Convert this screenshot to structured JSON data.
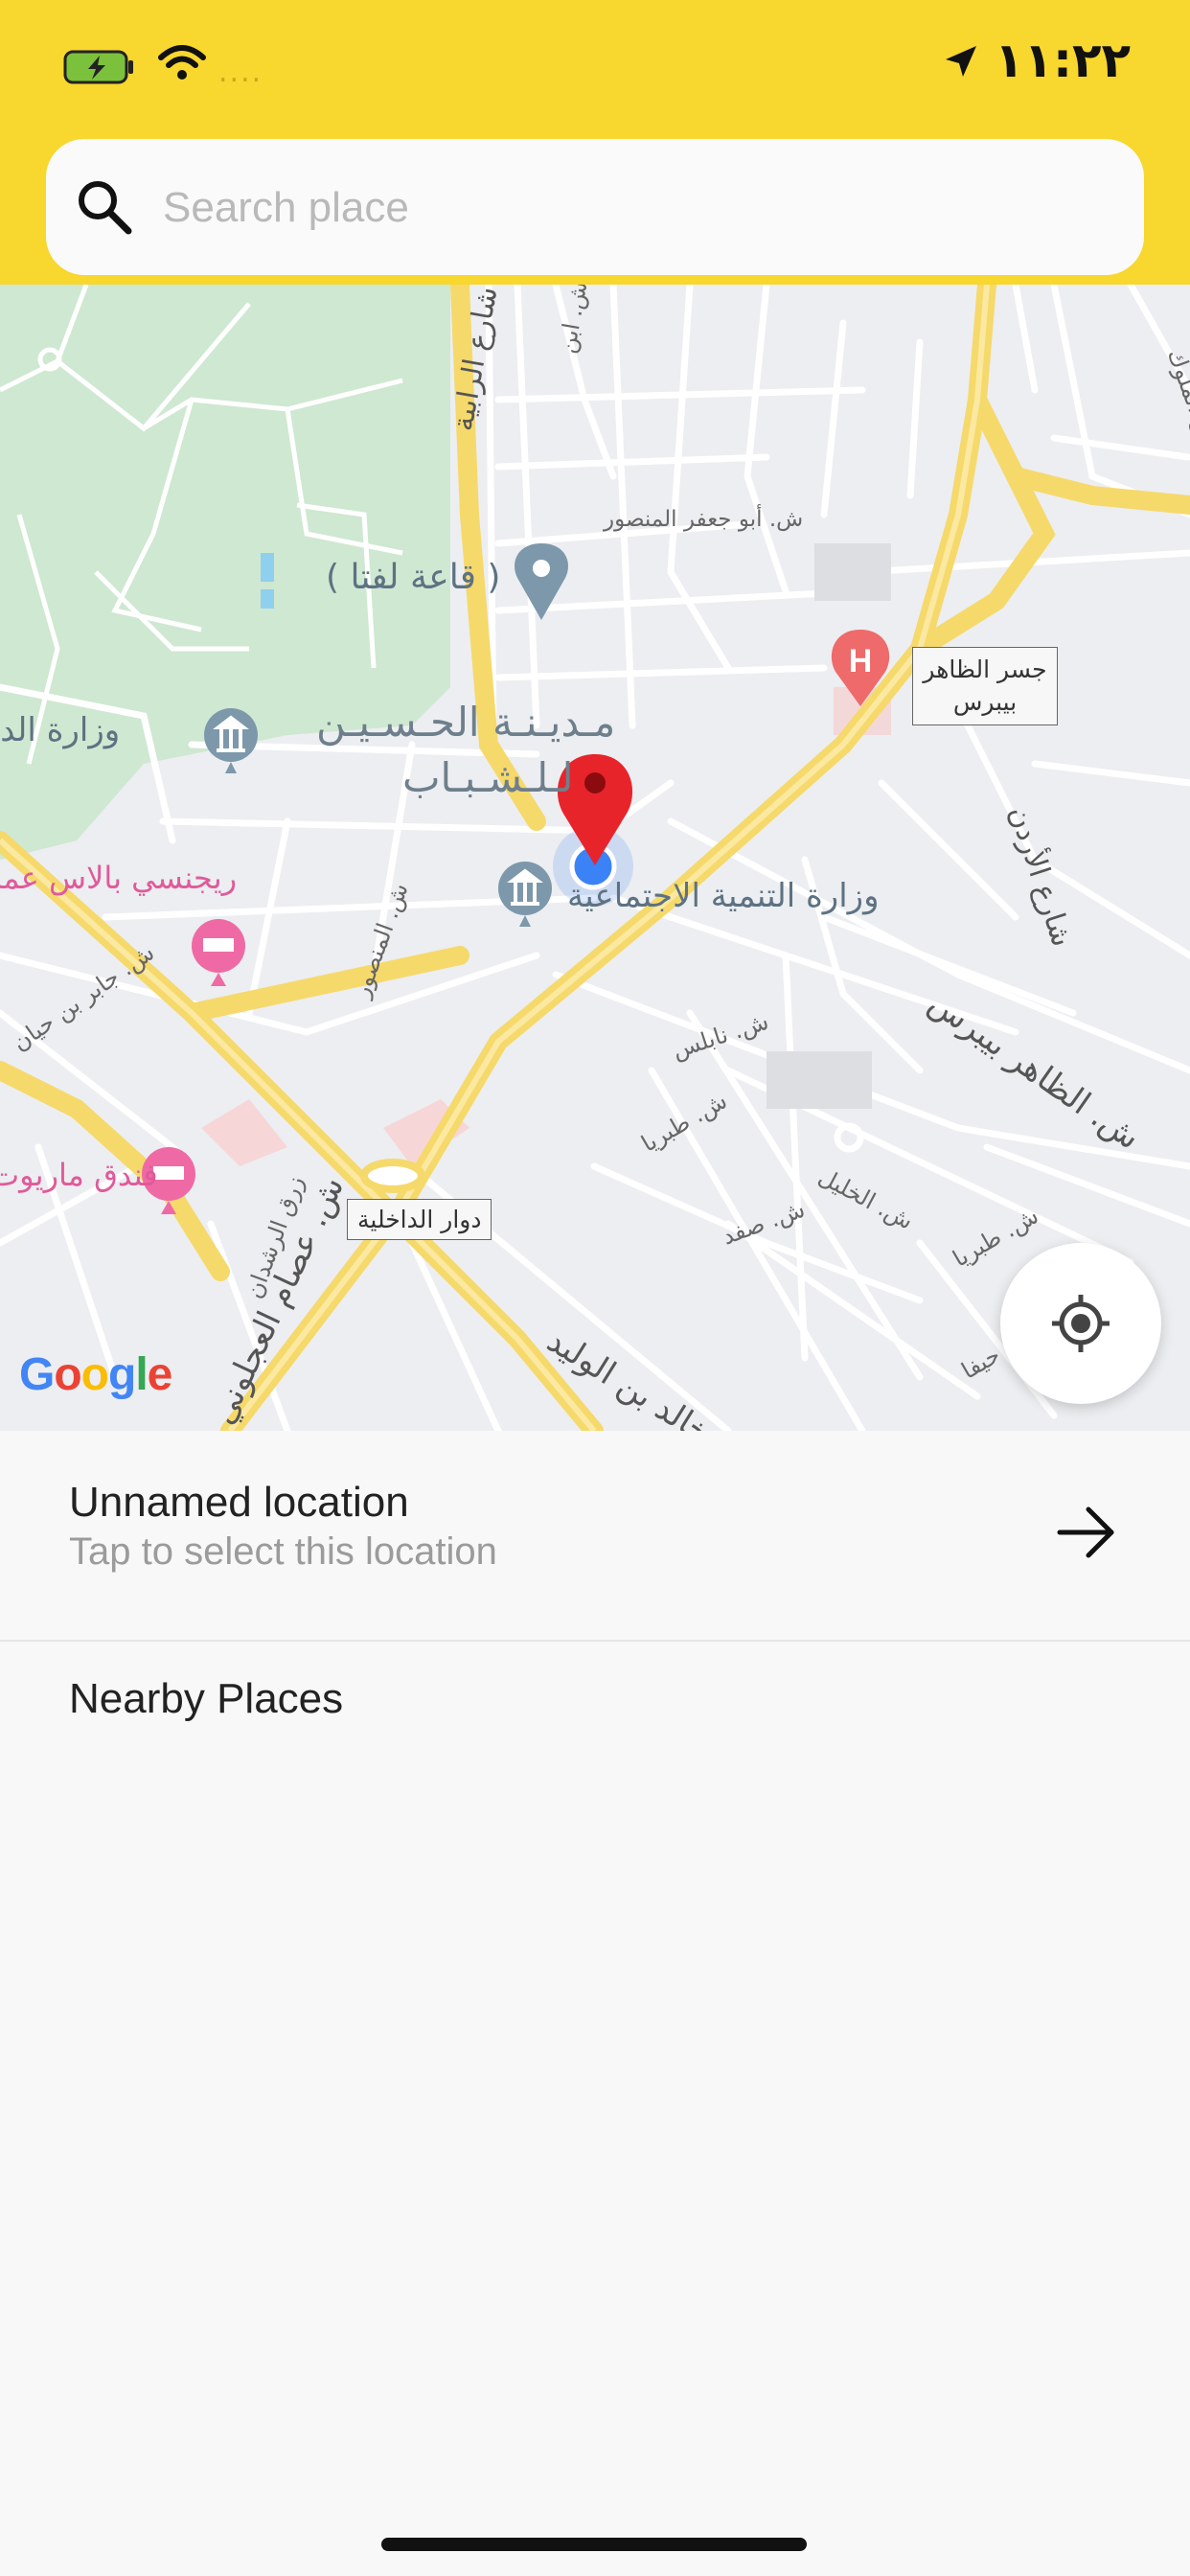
{
  "status_bar": {
    "time": "١١:٢٢",
    "carrier": "....",
    "icons": [
      "battery-charging-icon",
      "wifi-icon",
      "location-arrow-icon"
    ]
  },
  "search": {
    "placeholder": "Search place",
    "value": "",
    "icon": "search-icon"
  },
  "map": {
    "labels": {
      "qaat_lafta": "( قاعة لفتا )",
      "ministry_interior": "وزارة الداخلية",
      "al_hussein_city_1": "مـديـنـة الحـسـيـن",
      "al_hussein_city_2": "لـلـشـبـاب",
      "ministry_social": "وزارة التنمية الاجتماعية",
      "regency_palace": "ريجنسي بالاس عمان",
      "marriott": "فندق ماريوت",
      "street_abu_jaafar": "ش. أبو جعفر المنصور",
      "street_nablus": "ش. نابلس",
      "street_tabaria": "ش. طبريا",
      "street_safad": "ش. صفد",
      "street_khalil": "ش. الخليل",
      "street_mansour": "ش. المنصور",
      "street_jaber": "ش. جابر بن حيان",
      "street_essam": "ش. عصام العجلوني",
      "street_rashdan": "زرق الرشدان",
      "street_khalid": "خالد بن الوليد",
      "street_zaher": "ش. الظاهر بيبرس",
      "street_urdun": "شارع الأردن",
      "street_rabia": "شارع الرابية",
      "street_muluk": "شمس الملوك",
      "street_tabaria2": "ش. طبريا",
      "street_haifa": "ش. حيفا",
      "street_ibn": "ش. ابن",
      "box_bridge_1": "جسر الظاهر",
      "box_bridge_2": "بيبرس",
      "box_roundabout": "دوار الداخلية",
      "google": [
        "G",
        "o",
        "o",
        "g",
        "l",
        "e"
      ]
    },
    "colors": {
      "park": "#cfe8d1",
      "road_major": "#f6d96b",
      "road_minor": "#ffffff",
      "poi_blue": "#7d98ab",
      "poi_pink": "#ef6aa5",
      "poi_red": "#ef6a6a",
      "pin_red": "#e8242b",
      "location_blue": "#3b82f6"
    },
    "google_colors": [
      "#4285F4",
      "#EA4335",
      "#FBBC05",
      "#4285F4",
      "#34A853",
      "#EA4335"
    ]
  },
  "selected_location": {
    "title": "Unnamed location",
    "subtitle": "Tap to select this location",
    "action_icon": "arrow-right-icon"
  },
  "nearby": {
    "title": "Nearby Places"
  }
}
